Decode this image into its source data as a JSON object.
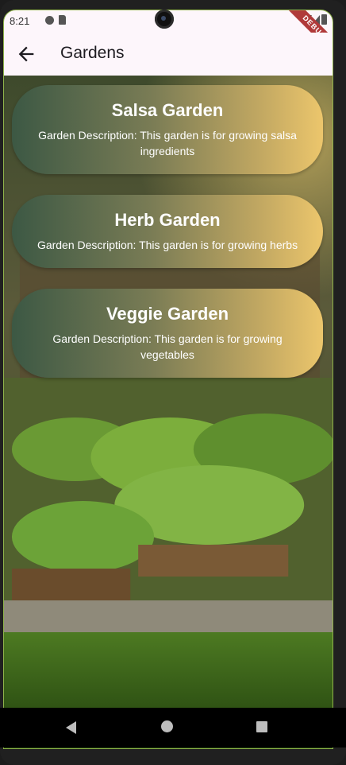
{
  "status_bar": {
    "time": "8:21",
    "debug_banner": "DEBUG"
  },
  "app_bar": {
    "title": "Gardens",
    "back_icon": "arrow-left-icon"
  },
  "gardens": [
    {
      "name": "Salsa Garden",
      "description": "Garden Description: This garden is for growing salsa ingredients"
    },
    {
      "name": "Herb Garden",
      "description": "Garden Description: This garden is for growing herbs"
    },
    {
      "name": "Veggie Garden",
      "description": "Garden Description: This garden is for growing vegetables"
    }
  ],
  "colors": {
    "card_gradient_start": "#3c5844",
    "card_gradient_end": "#ecc66c",
    "app_bar_bg": "#fdf6fb"
  },
  "nav_bar": {
    "icons": [
      "back-triangle-icon",
      "home-circle-icon",
      "recents-square-icon"
    ]
  }
}
